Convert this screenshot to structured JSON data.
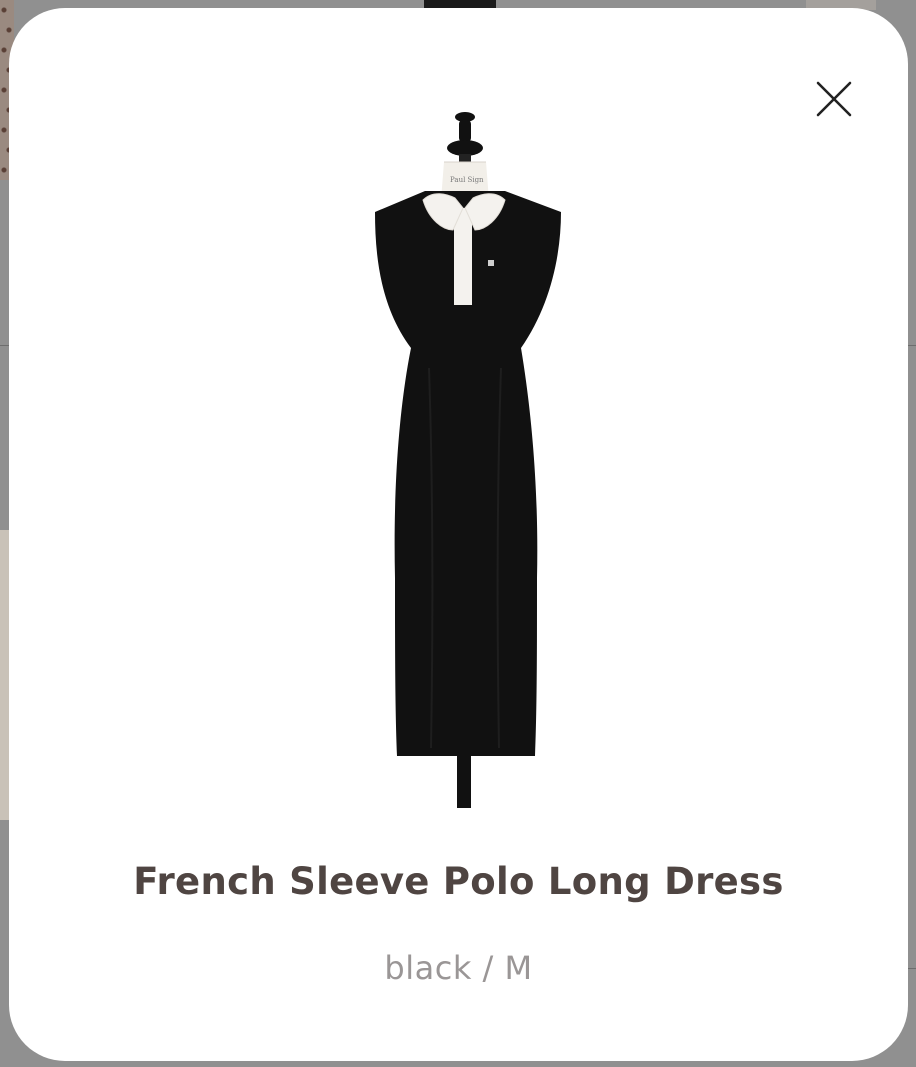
{
  "modal": {
    "close_icon": "close-icon",
    "product": {
      "title": "French Sleeve Polo Long Dress",
      "variant": "black / M",
      "image_icon": "dress-on-mannequin"
    }
  },
  "colors": {
    "title_text": "#4f4542",
    "variant_text": "#9a9696",
    "overlay": "#909090",
    "card": "#ffffff",
    "dress": "#111111",
    "collar": "#f4f2ee"
  }
}
